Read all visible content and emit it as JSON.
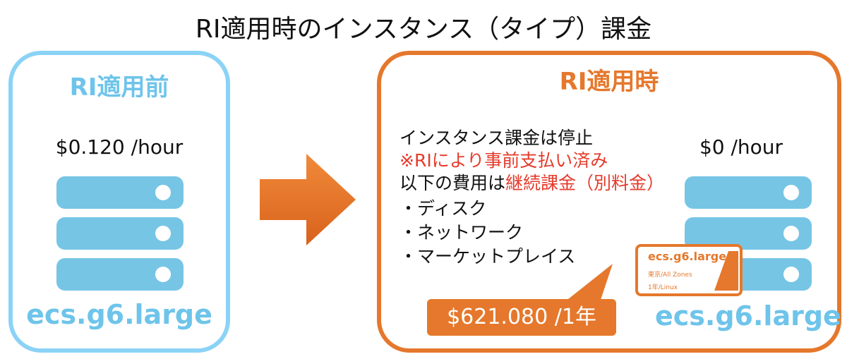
{
  "title": "RI適用時のインスタンス（タイプ）課金",
  "before": {
    "title": "RI適用前",
    "price": "$0.120 /hour",
    "model": "ecs.g6.large"
  },
  "after": {
    "title": "RI適用時",
    "price": "$0 /hour",
    "model": "ecs.g6.large",
    "info": {
      "line1": "インスタンス課金は停止",
      "line2": "※RIにより事前支払い済み",
      "line3_prefix": "以下の費用は",
      "line3_highlight": "継続課金（別料金）",
      "items": [
        "・ディスク",
        "・ネットワーク",
        "・マーケットプレイス"
      ]
    },
    "reserved_cost": "$621.080 /1年",
    "ri_card": {
      "type": "ecs.g6.large",
      "region": "東京/All Zones",
      "term": "1年/Linux"
    }
  },
  "colors": {
    "before_accent": "#8bd3f6",
    "after_accent": "#e5782c",
    "server": "#76c5e5",
    "highlight_text": "#e53b2c"
  },
  "icons": [
    "server-stack-icon",
    "arrow-right-icon"
  ]
}
